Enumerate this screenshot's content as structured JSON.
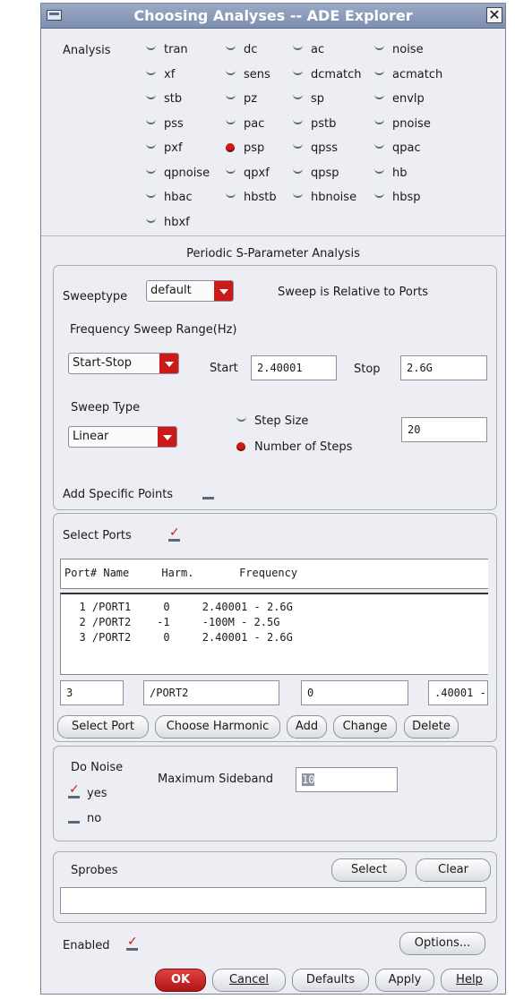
{
  "window": {
    "title": "Choosing Analyses -- ADE Explorer",
    "close_glyph": "✕"
  },
  "analysis": {
    "label": "Analysis",
    "options": [
      "tran",
      "dc",
      "ac",
      "noise",
      "xf",
      "sens",
      "dcmatch",
      "acmatch",
      "stb",
      "pz",
      "sp",
      "envlp",
      "pss",
      "pac",
      "pstb",
      "pnoise",
      "pxf",
      "psp",
      "qpss",
      "qpac",
      "qpnoise",
      "qpxf",
      "qpsp",
      "hb",
      "hbac",
      "hbstb",
      "hbnoise",
      "hbsp",
      "hbxf"
    ],
    "selected": "psp"
  },
  "section_title": "Periodic S-Parameter Analysis",
  "sweep": {
    "sweeptype_label": "Sweeptype",
    "sweeptype_value": "default",
    "relative_text": "Sweep is Relative to Ports",
    "freq_range_label": "Frequency Sweep Range(Hz)",
    "range_mode": "Start-Stop",
    "start_label": "Start",
    "start_value": "2.40001",
    "stop_label": "Stop",
    "stop_value": "2.6G",
    "sweep_type_label": "Sweep Type",
    "sweep_type_value": "Linear",
    "step_size_label": "Step Size",
    "num_steps_label": "Number of Steps",
    "num_steps_selected": true,
    "steps_value": "20",
    "specific_points_label": "Add Specific Points",
    "specific_points_checked": false
  },
  "ports": {
    "select_label": "Select Ports",
    "select_checked": true,
    "header": "Port# Name     Harm.       Frequency",
    "rows": [
      "  1 /PORT1     0     2.40001 - 2.6G",
      "  2 /PORT2    -1     -100M - 2.5G",
      "  3 /PORT2     0     2.40001 - 2.6G"
    ],
    "edit_port": "3",
    "edit_name": "/PORT2",
    "edit_harm": "0",
    "edit_freq": ".40001 -",
    "buttons": {
      "select_port": "Select Port",
      "choose_harmonic": "Choose Harmonic",
      "add": "Add",
      "change": "Change",
      "delete": "Delete"
    }
  },
  "noise": {
    "do_noise_label": "Do Noise",
    "yes_label": "yes",
    "yes_checked": true,
    "no_label": "no",
    "no_checked": false,
    "max_sideband_label": "Maximum Sideband",
    "max_sideband_value": "10"
  },
  "sprobes": {
    "label": "Sprobes",
    "select_button": "Select",
    "clear_button": "Clear",
    "value": ""
  },
  "footer": {
    "enabled_label": "Enabled",
    "enabled_checked": true,
    "options_button": "Options...",
    "ok": "OK",
    "cancel": "Cancel",
    "defaults": "Defaults",
    "apply": "Apply",
    "help": "Help"
  }
}
